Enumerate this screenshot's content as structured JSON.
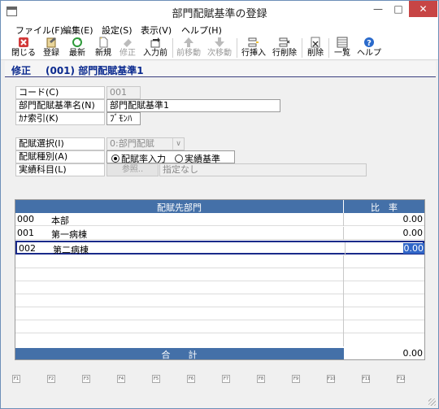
{
  "window": {
    "title": "部門配賦基準の登録",
    "minimize_glyph": "—",
    "maximize_glyph": "□",
    "close_glyph": "✕"
  },
  "menu": [
    {
      "label": "ファイル(F)"
    },
    {
      "label": "編集(E)"
    },
    {
      "label": "設定(S)"
    },
    {
      "label": "表示(V)"
    },
    {
      "label": "ヘルプ(H)"
    }
  ],
  "toolbar": [
    {
      "label": "閉じる",
      "icon": "close-red-x-icon",
      "disabled": false
    },
    {
      "label": "登録",
      "icon": "register-icon",
      "disabled": false
    },
    {
      "label": "最新",
      "icon": "refresh-icon",
      "disabled": false
    },
    {
      "label": "新規",
      "icon": "new-document-icon",
      "disabled": false
    },
    {
      "label": "修正",
      "icon": "eraser-icon",
      "disabled": true
    },
    {
      "label": "入力前",
      "icon": "undo-input-icon",
      "disabled": false
    },
    {
      "label": "前移動",
      "icon": "arrow-up-icon",
      "disabled": true
    },
    {
      "label": "次移動",
      "icon": "arrow-down-icon",
      "disabled": true
    },
    {
      "label": "行挿入",
      "icon": "insert-row-icon",
      "disabled": false
    },
    {
      "label": "行削除",
      "icon": "delete-row-icon",
      "disabled": false
    },
    {
      "label": "削除",
      "icon": "delete-icon",
      "disabled": false
    },
    {
      "label": "一覧",
      "icon": "list-icon",
      "disabled": false
    },
    {
      "label": "ヘルプ",
      "icon": "help-icon",
      "disabled": false
    }
  ],
  "mode": {
    "label": "修正",
    "title": "(001) 部門配賦基準1"
  },
  "form": {
    "code_label": "コード(C)",
    "code_value": "001",
    "name_label": "部門配賦基準名(N)",
    "name_value": "部門配賦基準1",
    "kana_label": "ｶﾅ索引(K)",
    "kana_value": "ﾌﾞﾓﾝﾊ",
    "select_label": "配賦選択(I)",
    "select_value": "0:部門配賦",
    "type_label": "配賦種別(A)",
    "type_option1": "配賦率入力",
    "type_option2": "実績基準",
    "type_selected": 1,
    "account_label": "実績科目(L)",
    "account_button": "参照..",
    "account_value": "指定なし"
  },
  "grid": {
    "header_dept": "配賦先部門",
    "header_rate": "比　率",
    "rows": [
      {
        "code": "000",
        "name": "本部",
        "rate": "0.00"
      },
      {
        "code": "001",
        "name": "第一病棟",
        "rate": "0.00"
      },
      {
        "code": "002",
        "name": "第二病棟",
        "rate": "0.00"
      }
    ],
    "selected_row": 2,
    "empty_rows": 7,
    "total_label": "合　　計",
    "total_value": "0.00"
  },
  "fkeys": [
    "F1",
    "F2",
    "F3",
    "F4",
    "F5",
    "F6",
    "F7",
    "F8",
    "F9",
    "F10",
    "F11",
    "F12"
  ]
}
